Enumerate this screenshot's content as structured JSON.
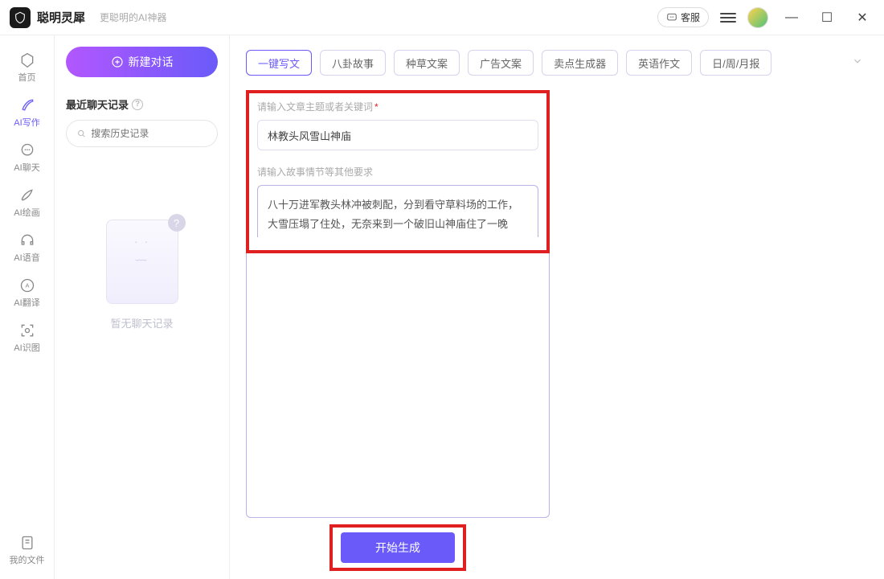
{
  "titlebar": {
    "app_name": "聪明灵犀",
    "tagline": "更聪明的AI神器",
    "kefu_label": "客服"
  },
  "nav": {
    "items": [
      {
        "label": "首页"
      },
      {
        "label": "AI写作"
      },
      {
        "label": "AI聊天"
      },
      {
        "label": "AI绘画"
      },
      {
        "label": "AI语音"
      },
      {
        "label": "AI翻译"
      },
      {
        "label": "AI识图"
      }
    ],
    "footer": {
      "label": "我的文件"
    }
  },
  "side": {
    "new_chat": "新建对话",
    "recent_title": "最近聊天记录",
    "search_placeholder": "搜索历史记录",
    "empty_text": "暂无聊天记录"
  },
  "main": {
    "tags": [
      "一键写文",
      "八卦故事",
      "种草文案",
      "广告文案",
      "卖点生成器",
      "英语作文",
      "日/周/月报"
    ],
    "label_topic": "请输入文章主题或者关键词",
    "topic_value": "林教头风雪山神庙",
    "label_detail": "请输入故事情节等其他要求",
    "detail_value": "八十万进军教头林冲被刺配，分到看守草料场的工作，大雪压塌了住处，无奈来到一个破旧山神庙住了一晚",
    "generate": "开始生成"
  }
}
